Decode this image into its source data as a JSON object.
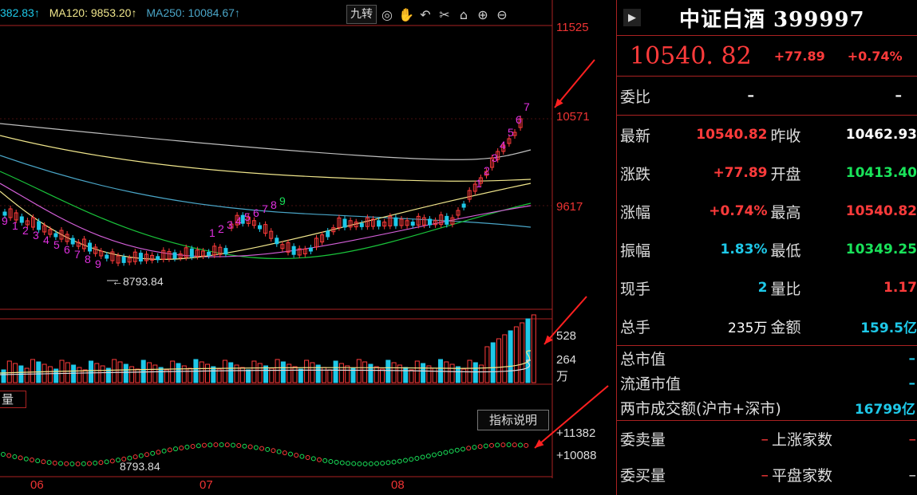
{
  "ma_bar": {
    "ma60": "382.83↑",
    "ma120": "MA120: 9853.20↑",
    "ma250": "MA250: 10084.67↑"
  },
  "toolbar": {
    "jiuzhuan": "九转",
    "icons": [
      "eye-icon",
      "hand-icon",
      "undo-icon",
      "scissors-icon",
      "home-icon",
      "zoom-in-icon",
      "zoom-out-icon"
    ]
  },
  "price_axis": [
    "11525",
    "10571",
    "9617"
  ],
  "low_marker": "←8793.84",
  "volume_axis": [
    "528",
    "264",
    "万"
  ],
  "volume_panel_label": "量",
  "indicator_button": "指标说明",
  "indicator_axis": [
    "+11382",
    "+10088"
  ],
  "indicator_low": "8793.84",
  "months": [
    "06",
    "07",
    "08"
  ],
  "td_counts": {
    "early_down": [
      "9",
      "1",
      "2",
      "3",
      "4",
      "5",
      "6",
      "7",
      "8",
      "9"
    ],
    "mid_up": [
      "1",
      "2",
      "3",
      "4",
      "5",
      "6",
      "7",
      "8",
      "9"
    ],
    "late_up": [
      "1",
      "2",
      "3",
      "4",
      "5",
      "6",
      "7"
    ]
  },
  "quote": {
    "title": "中证白酒 399997",
    "price": "10540. 82",
    "change": "+77.89",
    "pct": "+0.74%",
    "weibi_label": "委比",
    "weibi_v1": "–",
    "weibi_v2": "–",
    "rows": [
      {
        "l1": "最新",
        "v1": "10540.82",
        "l2": "昨收",
        "v2": "10462.93"
      },
      {
        "l1": "涨跌",
        "v1": "+77.89",
        "l2": "开盘",
        "v2": "10413.40"
      },
      {
        "l1": "涨幅",
        "v1": "+0.74%",
        "l2": "最高",
        "v2": "10540.82"
      },
      {
        "l1": "振幅",
        "v1": "1.83%",
        "l2": "最低",
        "v2": "10349.25"
      },
      {
        "l1": "现手",
        "v1": "2",
        "l2": "量比",
        "v2": "1.17"
      },
      {
        "l1": "总手",
        "v1": "235万",
        "l2": "金额",
        "v2": "159.5亿"
      }
    ],
    "mv_rows": [
      {
        "l": "总市值",
        "v": "–"
      },
      {
        "l": "流通市值",
        "v": "–"
      },
      {
        "l": "两市成交额(沪市+深市)",
        "v": "16799亿"
      }
    ],
    "bottom_rows": [
      {
        "l1": "委卖量",
        "v1": "–",
        "l2": "上涨家数",
        "v2": "–"
      },
      {
        "l1": "委买量",
        "v1": "–",
        "l2": "平盘家数",
        "v2": "–"
      }
    ]
  },
  "colors": {
    "up": "#ff3b3b",
    "down": "#1ec8e8",
    "green": "#19e35a",
    "border": "#aa2222"
  }
}
